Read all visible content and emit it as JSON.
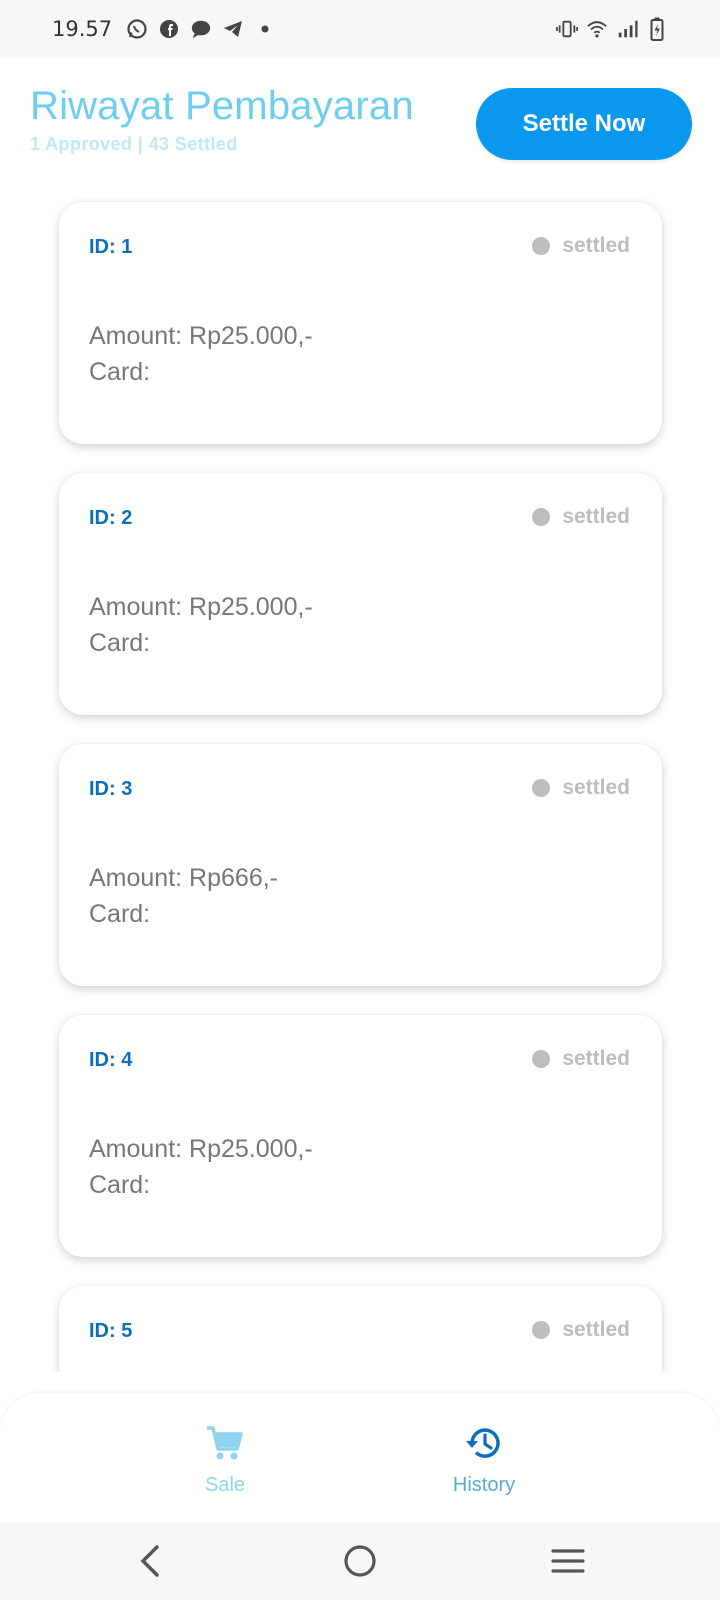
{
  "status_bar": {
    "time": "19.57",
    "icons_left": [
      "whatsapp-icon",
      "facebook-icon",
      "message-icon",
      "telegram-icon",
      "dot-icon"
    ],
    "icons_right": [
      "vibrate-icon",
      "wifi-icon",
      "signal-icon",
      "battery-icon"
    ]
  },
  "header": {
    "title": "Riwayat Pembayaran",
    "subtitle": "1 Approved | 43 Settled",
    "settle_button": "Settle Now"
  },
  "transactions": [
    {
      "id": "ID: 1",
      "status": "settled",
      "amount": "Amount: Rp25.000,-",
      "card": "Card:"
    },
    {
      "id": "ID: 2",
      "status": "settled",
      "amount": "Amount: Rp25.000,-",
      "card": "Card:"
    },
    {
      "id": "ID: 3",
      "status": "settled",
      "amount": "Amount: Rp666,-",
      "card": "Card:"
    },
    {
      "id": "ID: 4",
      "status": "settled",
      "amount": "Amount: Rp25.000,-",
      "card": "Card:"
    },
    {
      "id": "ID: 5",
      "status": "settled",
      "amount": "",
      "card": ""
    }
  ],
  "bottom_nav": {
    "sale_label": "Sale",
    "history_label": "History"
  },
  "colors": {
    "accent": "#0a98ee",
    "title": "#6ccff0",
    "id_text": "#0c6fb8",
    "status_grey": "#bdbdbd"
  }
}
